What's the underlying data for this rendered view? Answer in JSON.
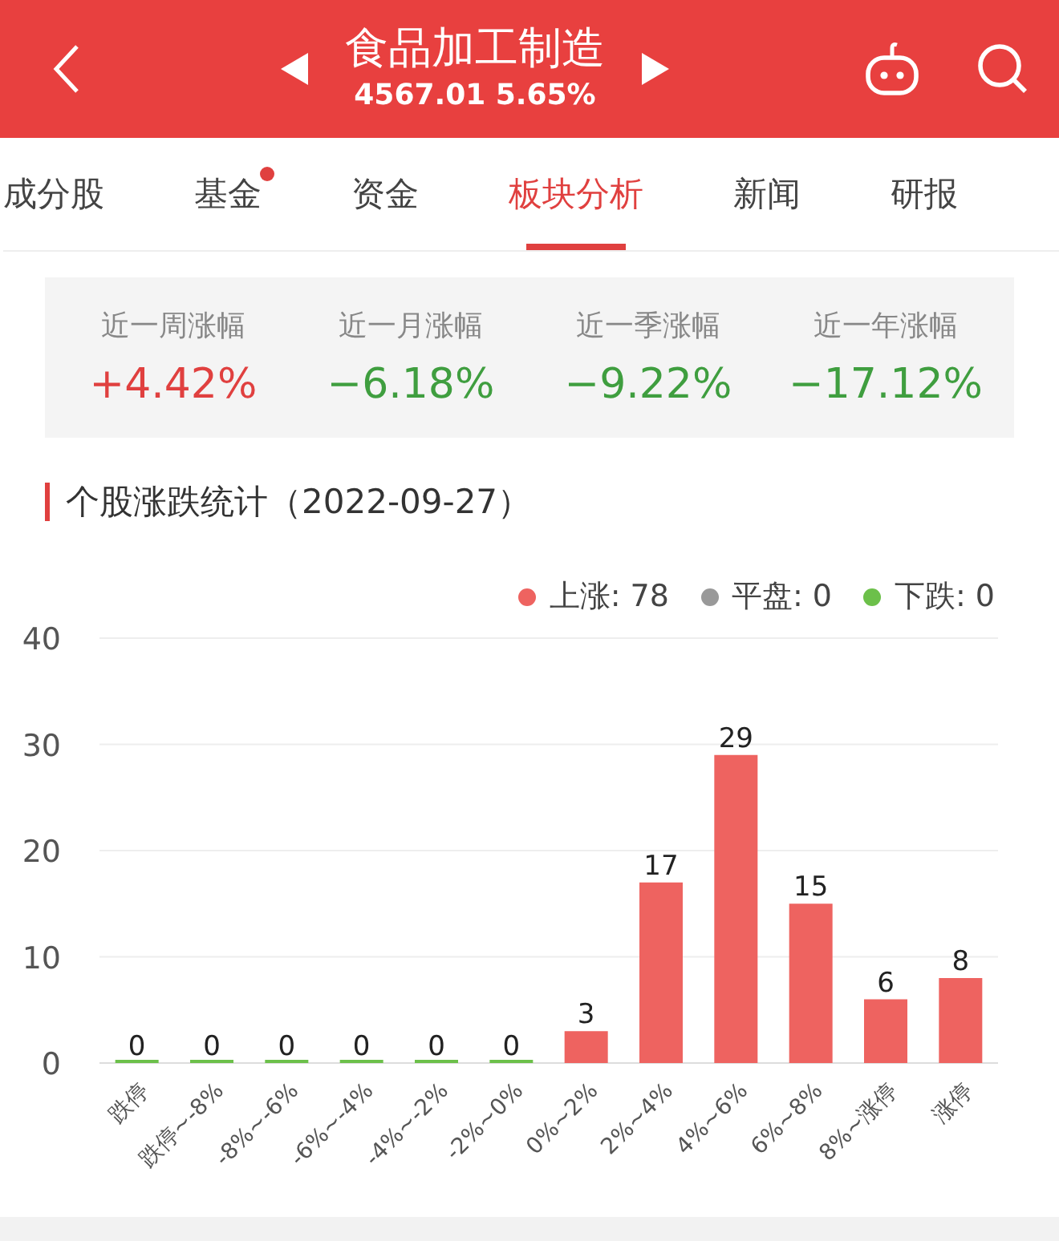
{
  "header": {
    "title": "食品加工制造",
    "quote": "4567.01 5.65%"
  },
  "tabs": [
    {
      "label": "成分股",
      "selected": false,
      "dot": false
    },
    {
      "label": "基金",
      "selected": false,
      "dot": true
    },
    {
      "label": "资金",
      "selected": false,
      "dot": false
    },
    {
      "label": "板块分析",
      "selected": true,
      "dot": false
    },
    {
      "label": "新闻",
      "selected": false,
      "dot": false
    },
    {
      "label": "研报",
      "selected": false,
      "dot": false
    }
  ],
  "stats": [
    {
      "label": "近一周涨幅",
      "value": "+4.42%",
      "color": "#e0403f"
    },
    {
      "label": "近一月涨幅",
      "value": "−6.18%",
      "color": "#3f9e3f"
    },
    {
      "label": "近一季涨幅",
      "value": "−9.22%",
      "color": "#3f9e3f"
    },
    {
      "label": "近一年涨幅",
      "value": "−17.12%",
      "color": "#3f9e3f"
    }
  ],
  "section_title": "个股涨跌统计（2022-09-27）",
  "legend_counts": [
    ": 78",
    ": 0",
    ": 0"
  ],
  "chart_data": {
    "type": "bar",
    "categories": [
      "跌停",
      "跌停~-8%",
      "-8%~-6%",
      "-6%~-4%",
      "-4%~-2%",
      "-2%~0%",
      "0%~2%",
      "2%~4%",
      "4%~6%",
      "6%~8%",
      "8%~涨停",
      "涨停"
    ],
    "series": [
      {
        "name": "上涨",
        "color": "#ee6360",
        "values": [
          null,
          null,
          null,
          null,
          null,
          null,
          3,
          17,
          29,
          15,
          6,
          8
        ]
      },
      {
        "name": "平盘",
        "color": "#999999",
        "values": [
          null,
          null,
          null,
          null,
          null,
          null,
          null,
          null,
          null,
          null,
          null,
          null
        ]
      },
      {
        "name": "下跌",
        "color": "#6cc04a",
        "values": [
          0,
          0,
          0,
          0,
          0,
          0,
          null,
          null,
          null,
          null,
          null,
          null
        ]
      }
    ],
    "ylim": [
      0,
      40
    ],
    "yticks": [
      0,
      10,
      20,
      30,
      40
    ],
    "grid": true,
    "data_labels": true
  }
}
